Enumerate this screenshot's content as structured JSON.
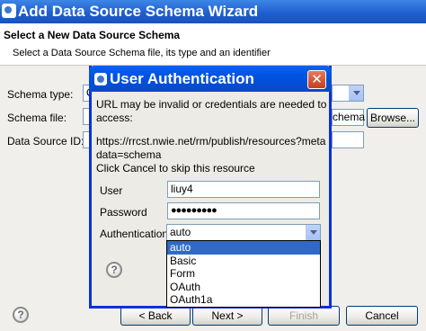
{
  "wizard": {
    "title": "Add Data Source Schema Wizard",
    "heading": "Select a New Data Source Schema",
    "description": "Select a Data Source Schema file, its type and an identifier",
    "schema_type_label": "Schema type:",
    "schema_type_value": "C",
    "schema_file_label": "Schema file:",
    "schema_file_value_partial": "chema",
    "browse_label": "Browse...",
    "data_source_id_label": "Data Source ID:",
    "back_label": "< Back",
    "next_label": "Next >",
    "finish_label": "Finish",
    "cancel_label": "Cancel",
    "help_glyph": "?"
  },
  "auth": {
    "title": "User Authentication",
    "close_glyph": "✕",
    "message_line1": "URL may be invalid or credentials are needed to",
    "message_line2": "access:",
    "url_line1": "https://rrcst.nwie.net/rm/publish/resources?meta",
    "url_line2": "data=schema",
    "cancel_hint": "Click Cancel to skip this resource",
    "user_label": "User",
    "user_value": "liuy4",
    "password_label": "Password",
    "password_value": "●●●●●●●●●",
    "authentication_label": "Authentication",
    "authentication_value": "auto",
    "options": [
      "auto",
      "Basic",
      "Form",
      "OAuth",
      "OAuth1a"
    ],
    "help_glyph": "?"
  },
  "colors": {
    "title_bar": "#1f5fd0",
    "selection": "#316ac5",
    "dialog_frame": "#0831d9",
    "close_button": "#c43f1e"
  }
}
